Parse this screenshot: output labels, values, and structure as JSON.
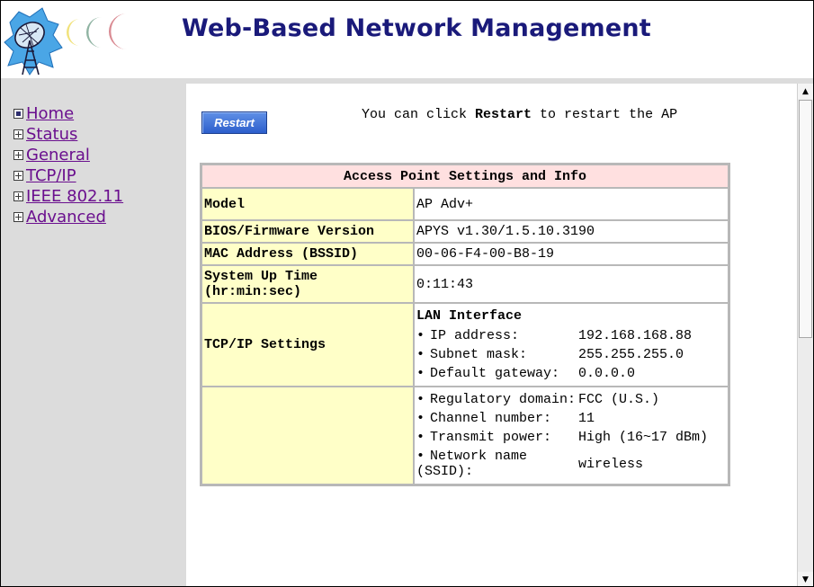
{
  "header": {
    "title": "Web-Based Network Management",
    "logo_icon": "satellite-dish-logo"
  },
  "sidebar": {
    "items": [
      {
        "label": "Home",
        "icon": "minus-box-icon"
      },
      {
        "label": "Status",
        "icon": "plus-box-icon"
      },
      {
        "label": "General",
        "icon": "plus-box-icon"
      },
      {
        "label": "TCP/IP",
        "icon": "plus-box-icon"
      },
      {
        "label": "IEEE 802.11",
        "icon": "plus-box-icon"
      },
      {
        "label": "Advanced",
        "icon": "plus-box-icon"
      }
    ]
  },
  "main": {
    "restart_button": "Restart",
    "restart_msg_pre": "You can click ",
    "restart_msg_bold": "Restart",
    "restart_msg_post": " to restart the AP",
    "table": {
      "title": "Access Point Settings and Info",
      "model_label": "Model",
      "model_value": "AP Adv+",
      "bios_label": "BIOS/Firmware Version",
      "bios_value": "APYS v1.30/1.5.10.3190",
      "mac_label": "MAC Address (BSSID)",
      "mac_value": "00-06-F4-00-B8-19",
      "uptime_label": "System Up Time (hr:min:sec)",
      "uptime_value": "0:11:43",
      "tcpip_label": "TCP/IP Settings",
      "lan_heading": "LAN Interface",
      "lan_items": [
        {
          "key": "IP address:",
          "value": "192.168.168.88"
        },
        {
          "key": "Subnet mask:",
          "value": "255.255.255.0"
        },
        {
          "key": "Default gateway:",
          "value": "0.0.0.0"
        }
      ],
      "wireless_items": [
        {
          "key": "Regulatory domain:",
          "value": "FCC (U.S.)"
        },
        {
          "key": "Channel number:",
          "value": "11"
        },
        {
          "key": "Transmit power:",
          "value": "High (16~17 dBm)"
        },
        {
          "key": "Network name (SSID):",
          "value": "wireless"
        }
      ]
    }
  },
  "colors": {
    "title": "#1a1a7a",
    "nav_link": "#6a0f8e",
    "table_header_bg": "#ffe0e0",
    "label_bg": "#ffffc8",
    "sidebar_bg": "#dcdcdc",
    "restart_button_bg": "#2d5fcc"
  }
}
